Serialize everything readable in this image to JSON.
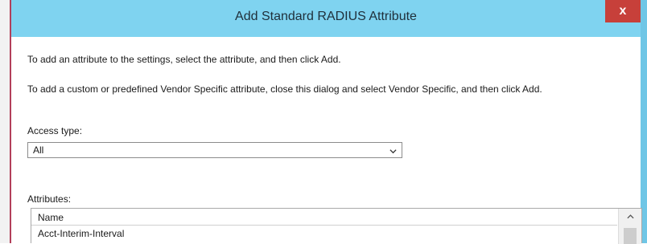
{
  "dialog": {
    "title": "Add Standard RADIUS Attribute",
    "close_label": "x"
  },
  "instructions": {
    "line1": "To add an attribute to the settings, select the attribute, and then click Add.",
    "line2": "To add a custom or predefined Vendor Specific attribute, close this dialog and select Vendor Specific, and then click Add."
  },
  "access_type": {
    "label": "Access type:",
    "selected": "All"
  },
  "attributes": {
    "label": "Attributes:",
    "column_header": "Name",
    "rows": [
      "Acct-Interim-Interval"
    ]
  },
  "icons": {
    "close": "close-icon",
    "dropdown": "chevron-down-icon",
    "scroll_up": "chevron-up-icon"
  },
  "colors": {
    "titlebar": "#7fd3f0",
    "close_button": "#c7403a"
  }
}
